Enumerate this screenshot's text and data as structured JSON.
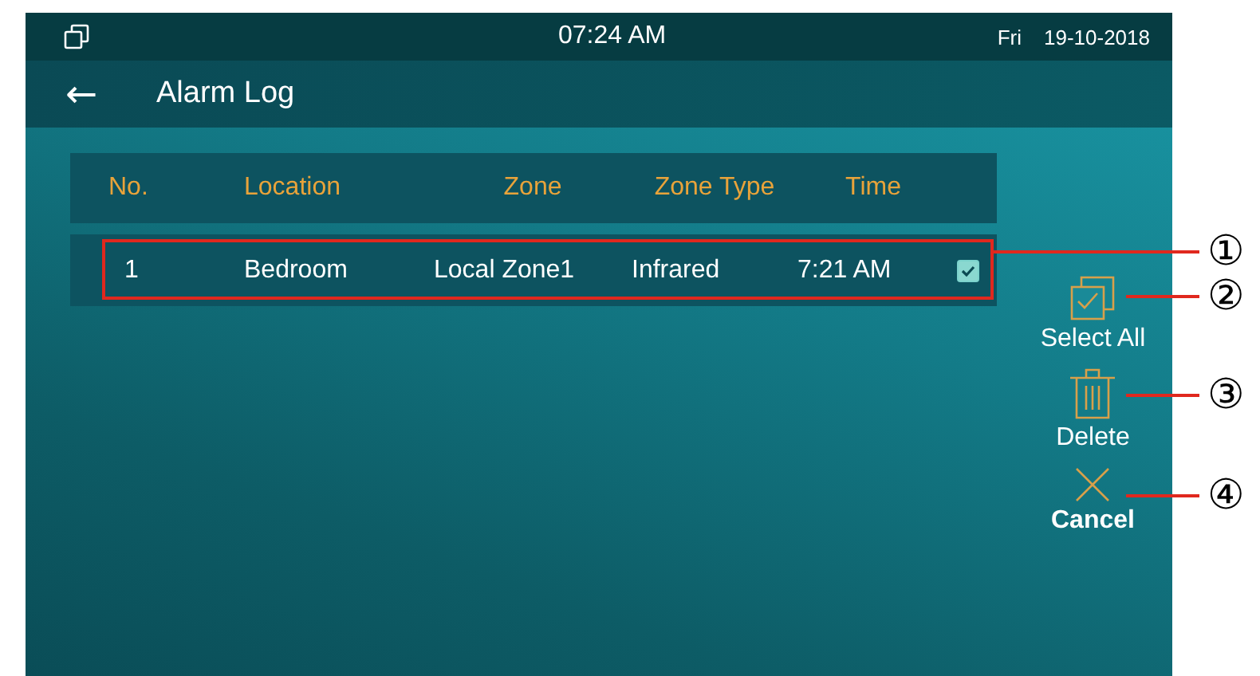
{
  "status_bar": {
    "time": "07:24 AM",
    "day": "Fri",
    "date": "19-10-2018"
  },
  "title_bar": {
    "back_icon": "←",
    "title": "Alarm Log"
  },
  "table": {
    "columns": [
      "No.",
      "Location",
      "Zone",
      "Zone Type",
      "Time"
    ],
    "rows": [
      {
        "cells": [
          "1",
          "Bedroom",
          "Local Zone1",
          "Infrared",
          "7:21 AM"
        ],
        "checked": true
      }
    ]
  },
  "actions": [
    {
      "kind": "select_all",
      "label": "Select All"
    },
    {
      "kind": "delete",
      "label": "Delete"
    },
    {
      "kind": "cancel",
      "label": "Cancel"
    }
  ],
  "callouts": [
    {
      "number": "①",
      "kind": "box"
    },
    {
      "number": "②",
      "kind": "line"
    },
    {
      "number": "③",
      "kind": "line"
    },
    {
      "number": "④",
      "kind": "line"
    }
  ]
}
